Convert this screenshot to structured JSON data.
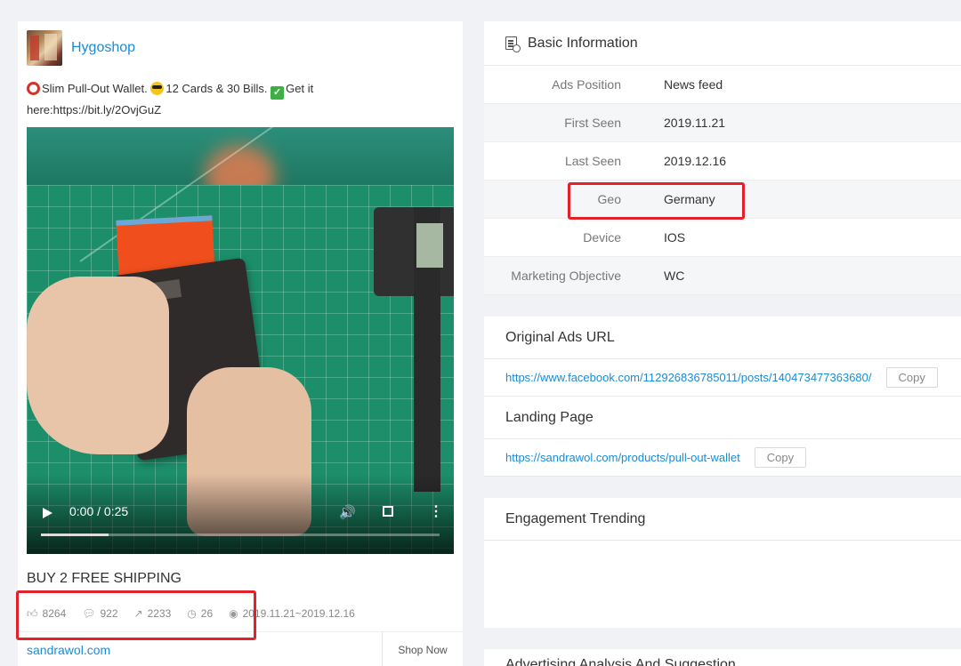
{
  "post": {
    "brand": "Hygoshop",
    "caption_part1": "Slim Pull-Out Wallet.",
    "caption_part2": "12 Cards & 30 Bills.",
    "caption_part3": "Get it",
    "caption_part4": "here:https://bit.ly/2OvjGuZ",
    "video": {
      "time": "0:00 / 0:25",
      "progress_percent": 17
    },
    "headline": "BUY 2 FREE SHIPPING",
    "stats": {
      "likes": "8264",
      "comments": "922",
      "shares": "2233",
      "days": "26",
      "date_range": "2019.11.21~2019.12.16"
    },
    "footer_link": "sandrawol.com",
    "cta": "Shop Now"
  },
  "basic_info": {
    "title": "Basic Information",
    "rows": [
      {
        "label": "Ads Position",
        "value": "News feed"
      },
      {
        "label": "First Seen",
        "value": "2019.11.21"
      },
      {
        "label": "Last Seen",
        "value": "2019.12.16"
      },
      {
        "label": "Geo",
        "value": "Germany"
      },
      {
        "label": "Device",
        "value": "IOS"
      },
      {
        "label": "Marketing Objective",
        "value": "WC"
      }
    ]
  },
  "original_ads": {
    "title": "Original Ads URL",
    "url": "https://www.facebook.com/112926836785011/posts/140473477363680/",
    "copy": "Copy"
  },
  "landing_page": {
    "title": "Landing Page",
    "url": "https://sandrawol.com/products/pull-out-wallet",
    "copy": "Copy"
  },
  "engagement": {
    "title": "Engagement Trending"
  },
  "analysis": {
    "title": "Advertising Analysis And Suggestion"
  },
  "colors": {
    "link": "#1a8cd8",
    "highlight": "#e3212b",
    "background": "#f0f2f5"
  }
}
